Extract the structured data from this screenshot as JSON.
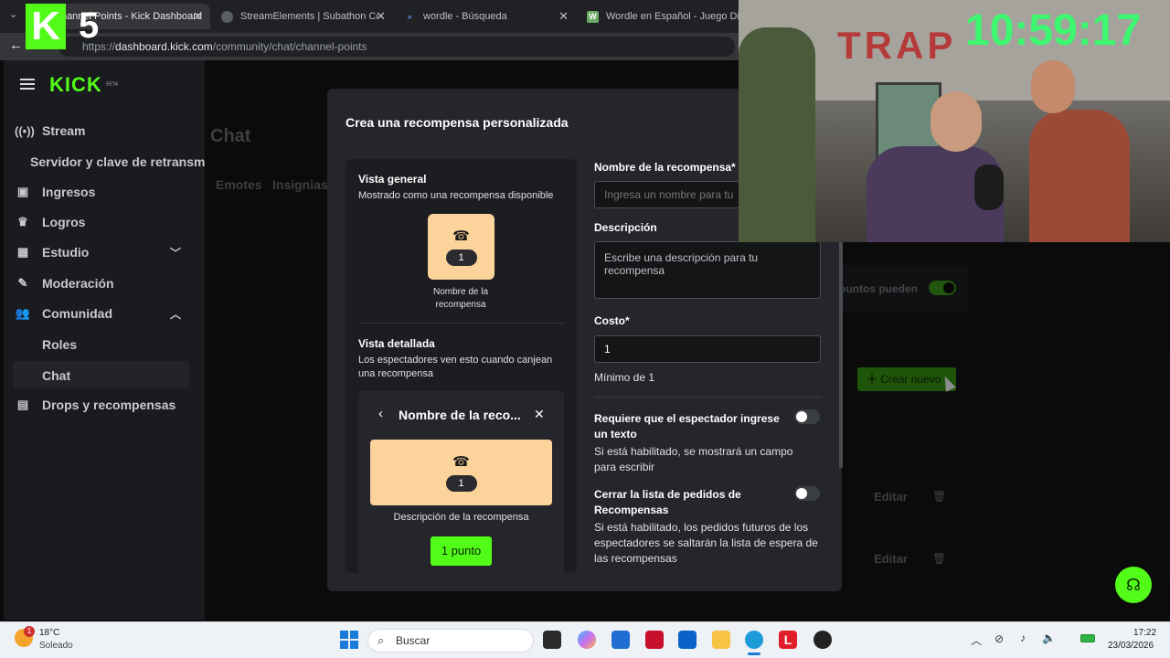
{
  "browser": {
    "tabs": [
      {
        "label": "Channel Points - Kick Dashboard",
        "active": true
      },
      {
        "label": "StreamElements | Subathon Countdown"
      },
      {
        "label": "wordle - Búsqueda"
      },
      {
        "label": "Wordle en Español - Juego Diario"
      }
    ],
    "url_prefix": "https://",
    "url_domain": "dashboard.kick.com",
    "url_path": "/community/chat/channel-points"
  },
  "logo": {
    "text": "KICK",
    "badge": "BETA"
  },
  "sidebar": {
    "items": [
      {
        "label": "Stream",
        "icon": "broadcast-icon"
      },
      {
        "label": "Servidor y clave de retransm"
      },
      {
        "label": "Ingresos",
        "icon": "wallet-icon"
      },
      {
        "label": "Logros",
        "icon": "trophy-icon"
      },
      {
        "label": "Estudio",
        "icon": "studio-icon"
      },
      {
        "label": "Moderación",
        "icon": "wrench-icon"
      },
      {
        "label": "Comunidad",
        "icon": "users-icon"
      },
      {
        "label": "Roles"
      },
      {
        "label": "Chat"
      },
      {
        "label": "Drops y recompensas",
        "icon": "gift-icon"
      }
    ]
  },
  "page": {
    "title": "Chat",
    "tabs": [
      "Emotes",
      "Insignias"
    ],
    "bg_toggle_label": "ountos pueden",
    "create_button": "Crear nuevo",
    "edit_labels": [
      "Editar",
      "Editar"
    ]
  },
  "modal": {
    "title": "Crea una recompensa personalizada",
    "overview": {
      "heading": "Vista general",
      "subtitle": "Mostrado como una recompensa disponible",
      "card_cost": "1",
      "card_name": "Nombre de la recompensa"
    },
    "detail": {
      "heading": "Vista detallada",
      "subtitle": "Los espectadores ven esto cuando canjean una recompensa",
      "popup_title": "Nombre de la reco...",
      "card_cost": "1",
      "description": "Descripción de la recompensa",
      "redeem_button": "1 punto"
    },
    "form": {
      "name_label": "Nombre de la recompensa*",
      "name_placeholder": "Ingresa un nombre para tu",
      "desc_label": "Descripción",
      "desc_placeholder": "Escribe una descripción para tu recompensa",
      "cost_label": "Costo*",
      "cost_value": "1",
      "cost_hint": "Mínimo de 1",
      "require_text_label": "Requiere que el espectador ingrese un texto",
      "require_text_hint": "Si está habilitado, se mostrará un campo para escribir",
      "close_queue_label": "Cerrar la lista de pedidos de Recompensas",
      "close_queue_hint": "Si está habilitado, los pedidos futuros de los espectadores se saltarán la lista de espera de las recompensas"
    }
  },
  "stream_overlay": {
    "clock": "10:59:17",
    "wall_text": "TRAP",
    "badge_k": "K",
    "badge_num": "5"
  },
  "taskbar": {
    "weather_temp": "18°C",
    "weather_desc": "Soleado",
    "weather_badge": "1",
    "search": "Buscar",
    "time": "17:22",
    "date": "23/03/2026"
  },
  "colors": {
    "kick_green": "#53fc18",
    "clock_green": "#3cf76f",
    "reward_card": "#fcd39a",
    "modal_bg": "#24262b"
  }
}
